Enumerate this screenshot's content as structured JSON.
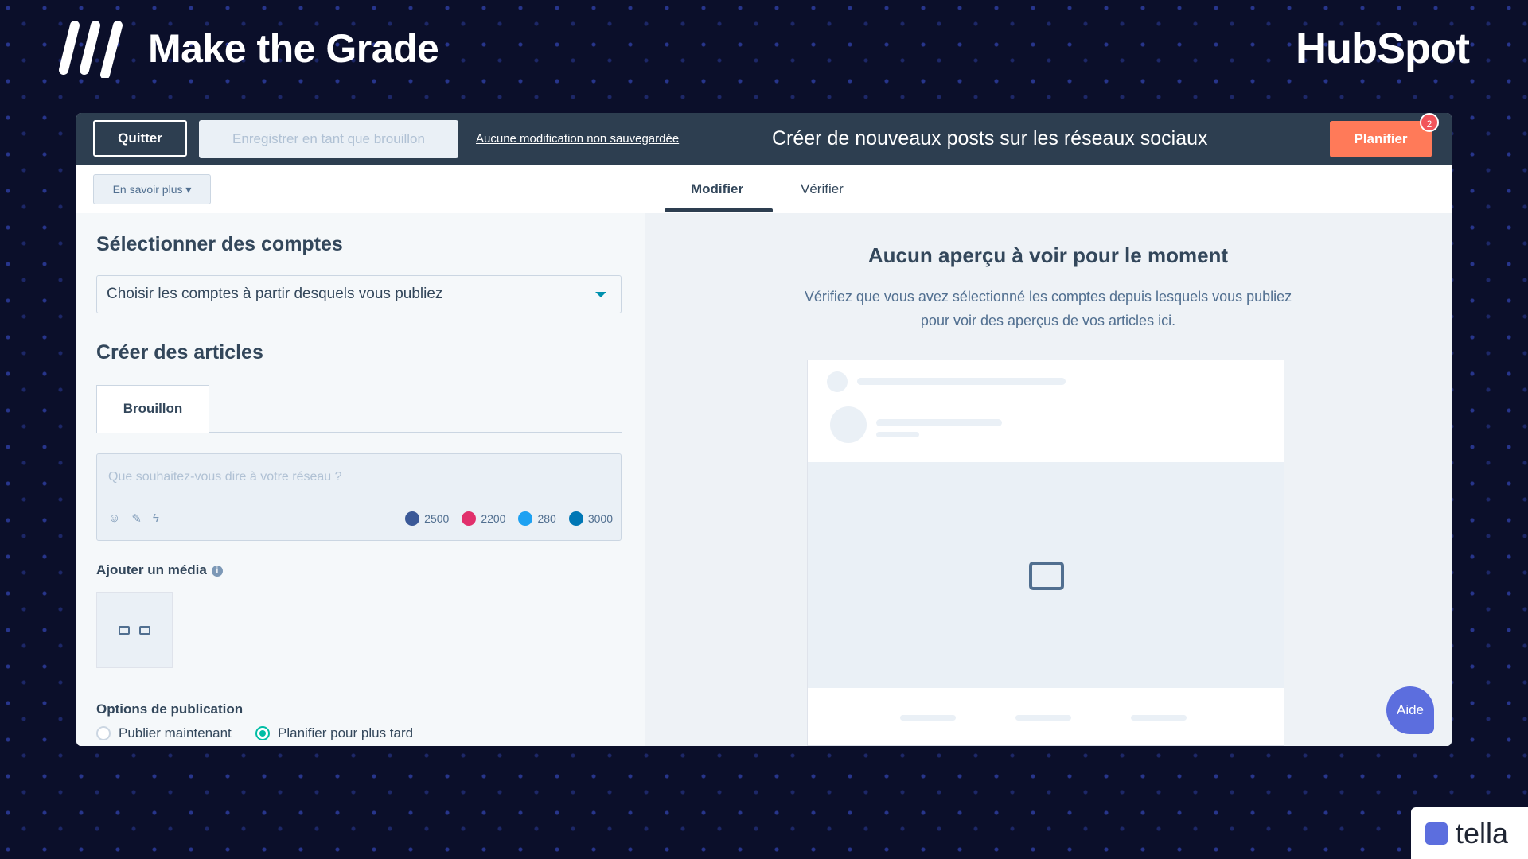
{
  "brand": {
    "title": "Make the Grade",
    "partner": "HubSpot"
  },
  "toolbar": {
    "quit": "Quitter",
    "save_draft": "Enregistrer en tant que brouillon",
    "save_status": "Aucune modification non sauvegardée",
    "title": "Créer de nouveaux posts sur les réseaux sociaux",
    "schedule": "Planifier",
    "notifications": "2"
  },
  "subbar": {
    "learn_more": "En savoir plus ▾",
    "tabs": [
      "Modifier",
      "Vérifier"
    ]
  },
  "accounts": {
    "heading": "Sélectionner des comptes",
    "placeholder": "Choisir les comptes à partir desquels vous publiez"
  },
  "articles": {
    "heading": "Créer des articles",
    "draft_tab": "Brouillon",
    "composer_placeholder": "Que souhaitez-vous dire à votre réseau ?",
    "limits": [
      {
        "network": "facebook",
        "value": "2500",
        "color": "#3b5998"
      },
      {
        "network": "instagram",
        "value": "2200",
        "color": "#e1306c"
      },
      {
        "network": "twitter",
        "value": "280",
        "color": "#1da1f2"
      },
      {
        "network": "linkedin",
        "value": "3000",
        "color": "#0077b5"
      }
    ]
  },
  "media": {
    "label": "Ajouter un média"
  },
  "publishing": {
    "label": "Options de publication",
    "options": [
      {
        "label": "Publier maintenant",
        "selected": false
      },
      {
        "label": "Planifier pour plus tard",
        "selected": true
      }
    ]
  },
  "preview": {
    "title": "Aucun aperçu à voir pour le moment",
    "description": "Vérifiez que vous avez sélectionné les comptes depuis lesquels vous publiez pour voir des aperçus de vos articles ici."
  },
  "help": "Aide",
  "watermark": "tella",
  "colors": {
    "accent": "#ff7a59",
    "dark": "#2d3e50",
    "teal": "#00bda5"
  }
}
